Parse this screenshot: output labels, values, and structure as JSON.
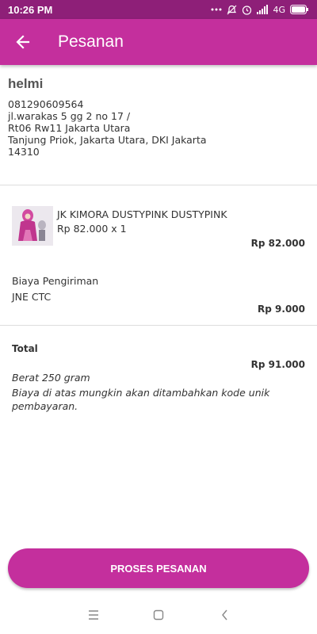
{
  "status_bar": {
    "time": "10:26 PM",
    "network": "4G"
  },
  "app_bar": {
    "title": "Pesanan"
  },
  "address": {
    "name": "helmi",
    "phone": "081290609564",
    "street": "jl.warakas 5 gg 2 no 17 /",
    "rt_rw": "Rt06 Rw11 Jakarta Utara",
    "district": "Tanjung Priok, Jakarta Utara, DKI Jakarta",
    "postal": "14310"
  },
  "product": {
    "name": "JK KIMORA DUSTYPINK DUSTYPINK",
    "unit_price": "Rp 82.000 x 1",
    "subtotal": "Rp 82.000"
  },
  "shipping": {
    "label": "Biaya Pengiriman",
    "courier": "JNE CTC",
    "cost": "Rp 9.000"
  },
  "summary": {
    "total_label": "Total",
    "total_value": "Rp 91.000",
    "weight": "Berat 250 gram",
    "note": "Biaya di atas mungkin akan ditambahkan kode unik pembayaran."
  },
  "cta": {
    "label": "PROSES PESANAN"
  },
  "colors": {
    "primary": "#c42f9d",
    "status_bar": "#8e1f78"
  }
}
